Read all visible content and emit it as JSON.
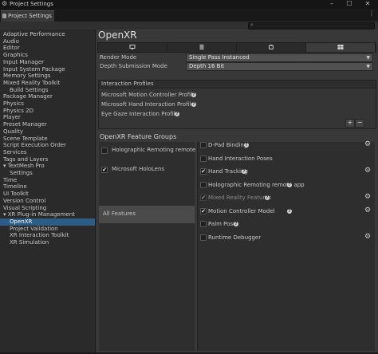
{
  "window": {
    "title": "Project Settings",
    "tab_label": "Project Settings"
  },
  "search": {
    "placeholder": ""
  },
  "tree": {
    "items": [
      {
        "label": "Adaptive Performance",
        "indent": 0
      },
      {
        "label": "Audio",
        "indent": 0
      },
      {
        "label": "Editor",
        "indent": 0
      },
      {
        "label": "Graphics",
        "indent": 0
      },
      {
        "label": "Input Manager",
        "indent": 0
      },
      {
        "label": "Input System Package",
        "indent": 0
      },
      {
        "label": "Memory Settings",
        "indent": 0
      },
      {
        "label": "Mixed Reality Toolkit",
        "indent": 0
      },
      {
        "label": "Build Settings",
        "indent": 2
      },
      {
        "label": "Package Manager",
        "indent": 0
      },
      {
        "label": "Physics",
        "indent": 0
      },
      {
        "label": "Physics 2D",
        "indent": 0
      },
      {
        "label": "Player",
        "indent": 0
      },
      {
        "label": "Preset Manager",
        "indent": 0
      },
      {
        "label": "Quality",
        "indent": 0
      },
      {
        "label": "Scene Template",
        "indent": 0
      },
      {
        "label": "Script Execution Order",
        "indent": 0
      },
      {
        "label": "Services",
        "indent": 0
      },
      {
        "label": "Tags and Layers",
        "indent": 0
      },
      {
        "label": "▾ TextMesh Pro",
        "indent": 0
      },
      {
        "label": "Settings",
        "indent": 2
      },
      {
        "label": "Time",
        "indent": 0
      },
      {
        "label": "Timeline",
        "indent": 0
      },
      {
        "label": "UI Toolkit",
        "indent": 0
      },
      {
        "label": "Version Control",
        "indent": 0
      },
      {
        "label": "Visual Scripting",
        "indent": 0
      },
      {
        "label": "▾ XR Plug-in Management",
        "indent": 0
      },
      {
        "label": "OpenXR",
        "indent": 2,
        "selected": true
      },
      {
        "label": "Project Validation",
        "indent": 2
      },
      {
        "label": "XR Interaction Toolkit",
        "indent": 2
      },
      {
        "label": "XR Simulation",
        "indent": 2
      }
    ]
  },
  "main": {
    "title": "OpenXR",
    "platform_tabs": [
      {
        "icon": "monitor-icon"
      },
      {
        "icon": "server-icon"
      },
      {
        "icon": "android-icon"
      },
      {
        "icon": "windows-icon",
        "active": true
      }
    ],
    "render_mode": {
      "label": "Render Mode",
      "value": "Single Pass Instanced"
    },
    "depth_mode": {
      "label": "Depth Submission Mode",
      "value": "Depth 16 Bit"
    },
    "interaction_profiles": {
      "header": "Interaction Profiles",
      "items": [
        "Microsoft Motion Controller Profile",
        "Microsoft Hand Interaction Profile",
        "Eye Gaze Interaction Profile"
      ],
      "add_label": "+",
      "remove_label": "−"
    },
    "feature_groups": {
      "title": "OpenXR Feature Groups",
      "groups": [
        {
          "label": "Holographic Remoting remote app",
          "checked": false
        },
        {
          "label": "Microsoft HoloLens",
          "checked": true
        },
        {
          "label": "All Features",
          "selected": true,
          "no_checkbox": true
        }
      ]
    },
    "features": [
      {
        "label": "D-Pad Binding",
        "checked": false,
        "help": true,
        "gear": true
      },
      {
        "label": "Hand Interaction Poses",
        "checked": false,
        "help": false,
        "gear": false
      },
      {
        "label": "Hand Tracking",
        "checked": true,
        "help": true,
        "gear": true
      },
      {
        "label": "Holographic Remoting remote app",
        "checked": false,
        "help": true,
        "gear": false
      },
      {
        "label": "Mixed Reality Features",
        "checked": true,
        "disabled": true,
        "help": true,
        "gear": true
      },
      {
        "label": "Motion Controller Model",
        "checked": true,
        "help": true,
        "gear": true
      },
      {
        "label": "Palm Pose",
        "checked": false,
        "help": true,
        "gear": false
      },
      {
        "label": "Runtime Debugger",
        "checked": false,
        "help": false,
        "gear": true
      }
    ],
    "help_glyph": "?",
    "gear_glyph": "⚙",
    "check_glyph": "✔"
  }
}
